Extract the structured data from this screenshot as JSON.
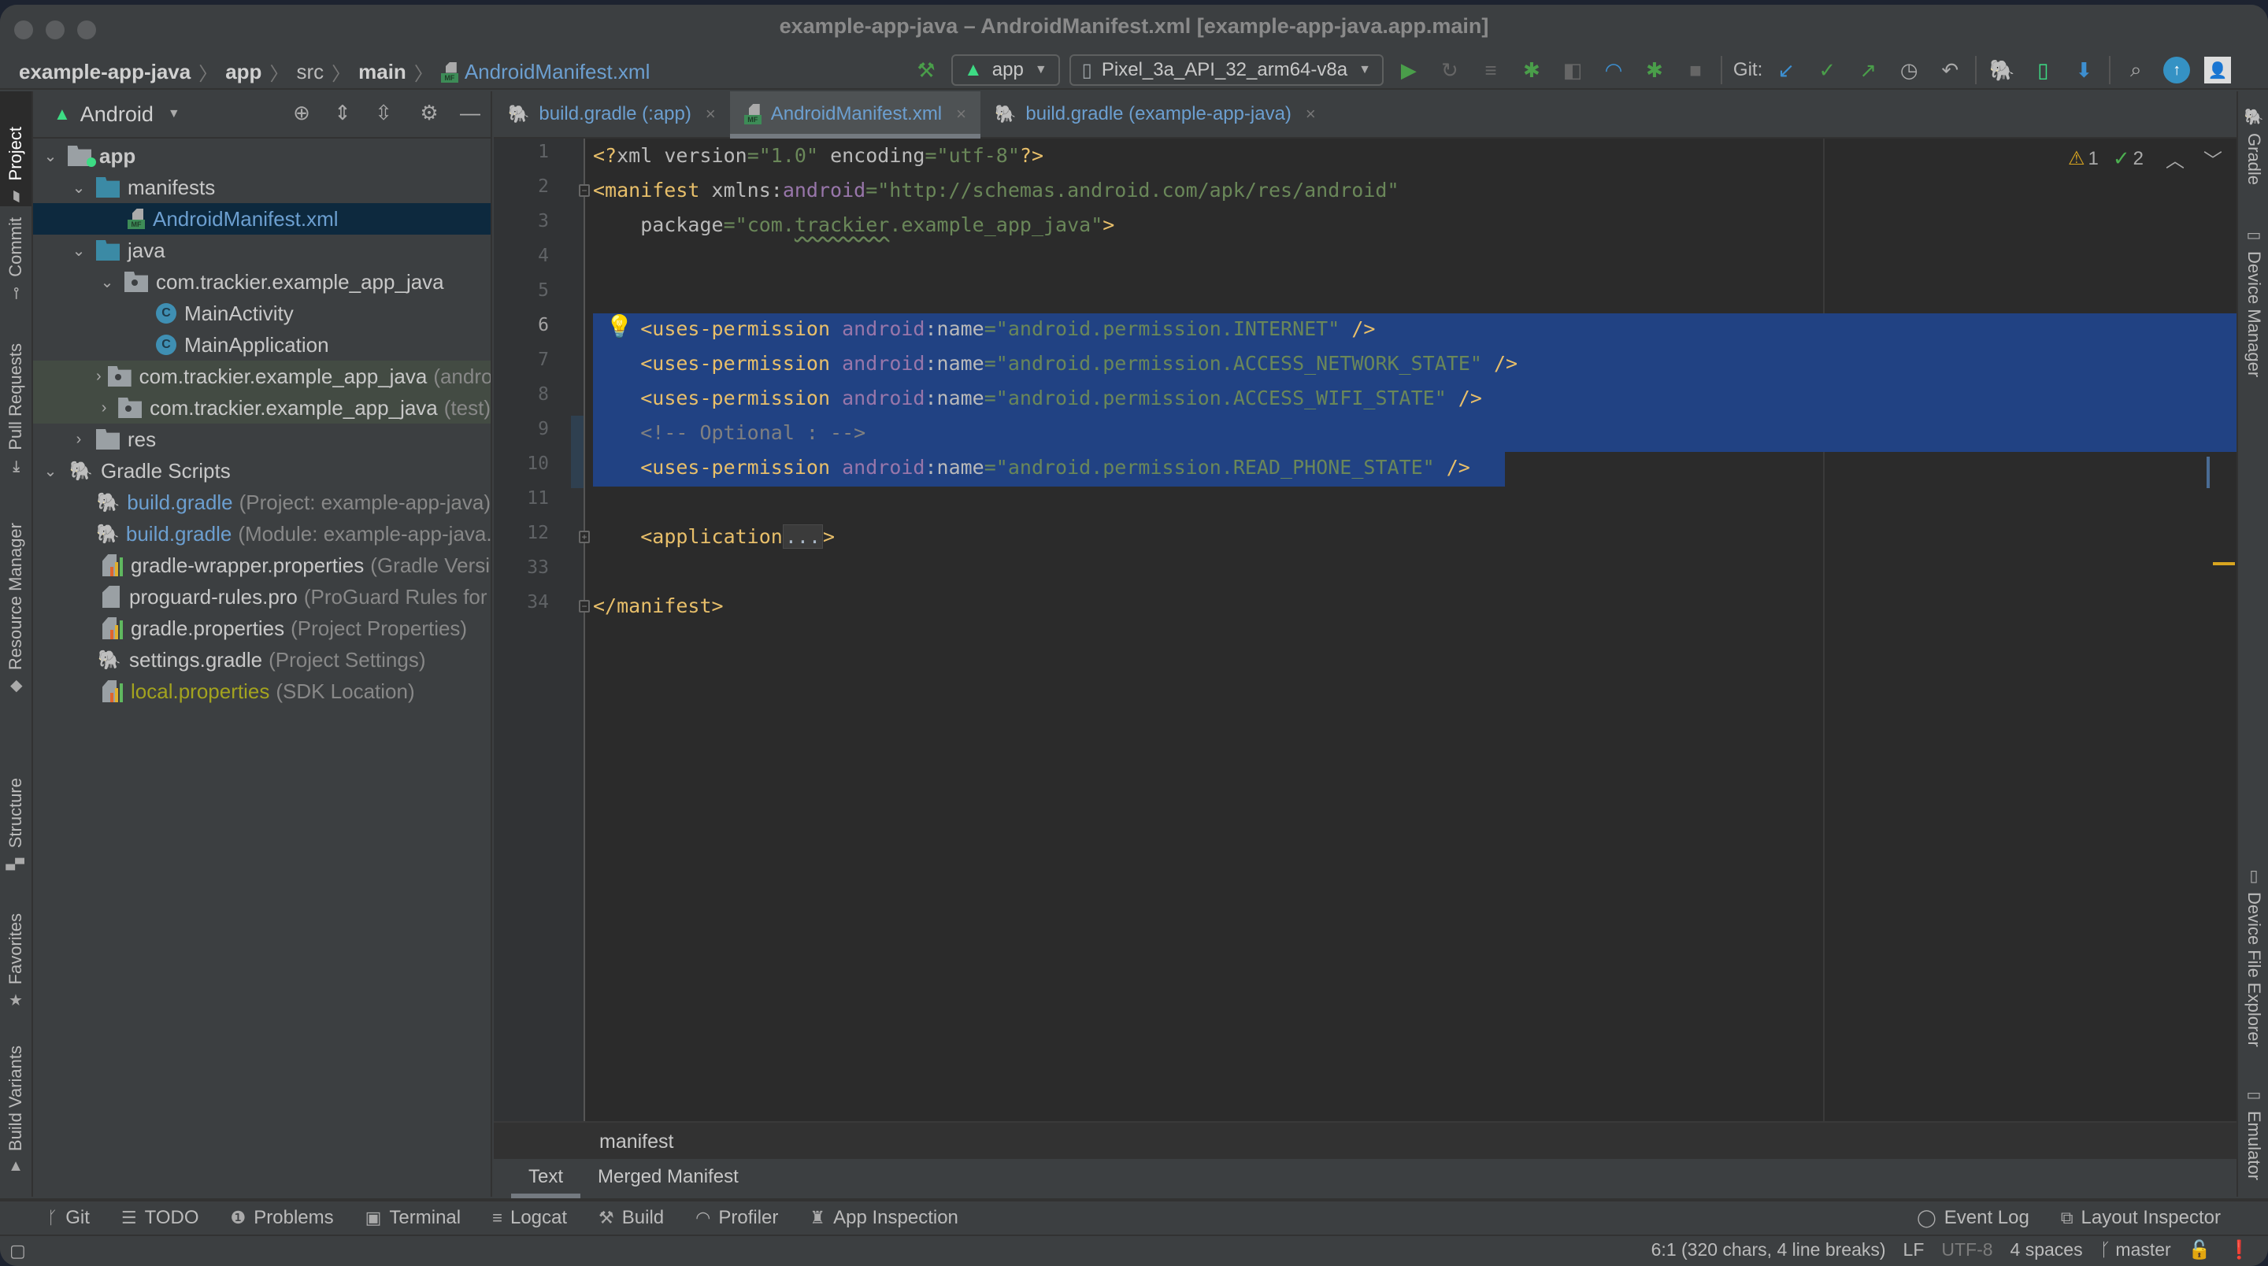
{
  "window": {
    "title": "example-app-java – AndroidManifest.xml [example-app-java.app.main]"
  },
  "breadcrumb": {
    "items": [
      {
        "label": "example-app-java"
      },
      {
        "label": "app"
      },
      {
        "label": "src"
      },
      {
        "label": "main"
      },
      {
        "label": "AndroidManifest.xml"
      }
    ]
  },
  "toolbar": {
    "run_config": "app",
    "device": "Pixel_3a_API_32_arm64-v8a",
    "git_label": "Git:",
    "icons": [
      "hammer-icon",
      "run-icon",
      "apply-changes-icon",
      "apply-code-changes-icon",
      "debug-icon",
      "attach-debugger-icon",
      "profile-icon",
      "attach-process-icon",
      "stop-icon",
      "git-update-icon",
      "git-commit-icon",
      "git-push-icon",
      "history-icon",
      "rollback-icon",
      "gradle-sync-icon",
      "avd-manager-icon",
      "sdk-manager-icon",
      "search-icon",
      "update-icon",
      "account-icon"
    ]
  },
  "left_strip": {
    "items": [
      {
        "label": "Project",
        "active": true
      },
      {
        "label": "Commit"
      },
      {
        "label": "Pull Requests"
      },
      {
        "label": "Resource Manager"
      },
      {
        "label": "Structure"
      },
      {
        "label": "Favorites"
      },
      {
        "label": "Build Variants"
      }
    ]
  },
  "right_strip": {
    "items": [
      {
        "label": "Gradle"
      },
      {
        "label": "Device Manager"
      },
      {
        "label": "Device File Explorer"
      },
      {
        "label": "Emulator"
      }
    ]
  },
  "project": {
    "view_label": "Android",
    "tree": [
      {
        "label": "app",
        "level": 0,
        "expanded": true,
        "icon": "module"
      },
      {
        "label": "manifests",
        "level": 1,
        "expanded": true,
        "icon": "folder"
      },
      {
        "label": "AndroidManifest.xml",
        "level": 2,
        "icon": "manifest",
        "selected": true
      },
      {
        "label": "java",
        "level": 1,
        "expanded": true,
        "icon": "folder"
      },
      {
        "label": "com.trackier.example_app_java",
        "level": 2,
        "expanded": true,
        "icon": "package"
      },
      {
        "label": "MainActivity",
        "level": 3,
        "icon": "class"
      },
      {
        "label": "MainApplication",
        "level": 3,
        "icon": "class"
      },
      {
        "label": "com.trackier.example_app_java",
        "suffix": "(androidTest)",
        "level": 2,
        "collapsed": true,
        "icon": "package",
        "test": true
      },
      {
        "label": "com.trackier.example_app_java",
        "suffix": "(test)",
        "level": 2,
        "collapsed": true,
        "icon": "package",
        "test": true
      },
      {
        "label": "res",
        "level": 1,
        "collapsed": true,
        "icon": "res-folder"
      },
      {
        "label": "Gradle Scripts",
        "level": 0,
        "expanded": true,
        "icon": "gradle"
      },
      {
        "label": "build.gradle",
        "suffix": "(Project: example-app-java)",
        "level": 1,
        "icon": "gradle",
        "color": "blue"
      },
      {
        "label": "build.gradle",
        "suffix": "(Module: example-app-java.app)",
        "level": 1,
        "icon": "gradle",
        "color": "blue"
      },
      {
        "label": "gradle-wrapper.properties",
        "suffix": "(Gradle Version)",
        "level": 1,
        "icon": "properties"
      },
      {
        "label": "proguard-rules.pro",
        "suffix": "(ProGuard Rules for example-app-java.app)",
        "level": 1,
        "icon": "text"
      },
      {
        "label": "gradle.properties",
        "suffix": "(Project Properties)",
        "level": 1,
        "icon": "properties"
      },
      {
        "label": "settings.gradle",
        "suffix": "(Project Settings)",
        "level": 1,
        "icon": "gradle"
      },
      {
        "label": "local.properties",
        "suffix": "(SDK Location)",
        "level": 1,
        "icon": "properties",
        "color": "olive"
      }
    ]
  },
  "tabs": [
    {
      "label": "build.gradle (:app)",
      "icon": "gradle"
    },
    {
      "label": "AndroidManifest.xml",
      "icon": "manifest",
      "active": true
    },
    {
      "label": "build.gradle (example-app-java)",
      "icon": "gradle"
    }
  ],
  "editor": {
    "line_numbers": [
      "1",
      "2",
      "3",
      "4",
      "5",
      "6",
      "7",
      "8",
      "9",
      "10",
      "11",
      "12",
      "33",
      "34"
    ],
    "current_line": "6",
    "lines": {
      "l1": {
        "p1": "<?",
        "p2": "xml",
        "p3": " version",
        "p4": "=",
        "p5": "\"1.0\"",
        "p6": " encoding",
        "p7": "=",
        "p8": "\"utf-8\"",
        "p9": "?>"
      },
      "l2": {
        "p1": "<manifest",
        "p2": " xmlns:",
        "p3": "android",
        "p4": "=",
        "p5": "\"http://schemas.android.com/apk/res/android\""
      },
      "l3": {
        "p1": "    package",
        "p2": "=",
        "p3": "\"com.",
        "p4": "trackier",
        "p5": ".example_app_java\"",
        "p6": ">"
      },
      "perm_tag": "<uses-permission",
      "perm_ns": "android",
      "perm_attr": ":name",
      "perm_eq": "=",
      "perm_close": " />",
      "permissions": [
        "\"android.permission.INTERNET\"",
        "\"android.permission.ACCESS_NETWORK_STATE\"",
        "\"android.permission.ACCESS_WIFI_STATE\"",
        "\"android.permission.READ_PHONE_STATE\""
      ],
      "comment": "<!-- Optional : -->",
      "app_open": "<application",
      "app_fold": "...",
      "app_close": ">",
      "manifest_close": "</manifest>"
    },
    "inspections": {
      "warnings": "1",
      "weak_warnings": "2"
    }
  },
  "xml_breadcrumb": "manifest",
  "manifest_tabs": [
    {
      "label": "Text",
      "active": true
    },
    {
      "label": "Merged Manifest"
    }
  ],
  "bottom_tools": {
    "left": [
      {
        "label": "Git",
        "icon": "git-branch-icon"
      },
      {
        "label": "TODO",
        "icon": "list-icon"
      },
      {
        "label": "Problems",
        "icon": "problems-icon"
      },
      {
        "label": "Terminal",
        "icon": "terminal-icon"
      },
      {
        "label": "Logcat",
        "icon": "logcat-icon"
      },
      {
        "label": "Build",
        "icon": "hammer-icon"
      },
      {
        "label": "Profiler",
        "icon": "profiler-icon"
      },
      {
        "label": "App Inspection",
        "icon": "inspection-icon"
      }
    ],
    "right": [
      {
        "label": "Event Log",
        "icon": "event-log-icon"
      },
      {
        "label": "Layout Inspector",
        "icon": "layout-inspector-icon"
      }
    ]
  },
  "status": {
    "position": "6:1 (320 chars, 4 line breaks)",
    "line_sep": "LF",
    "encoding": "UTF-8",
    "indent": "4 spaces",
    "branch": "master"
  },
  "colors": {
    "selection": "#214283",
    "tag": "#e8bf6a",
    "string": "#6a8759",
    "namespace": "#9876aa",
    "comment": "#808080",
    "link_blue": "#6c9fd0"
  }
}
